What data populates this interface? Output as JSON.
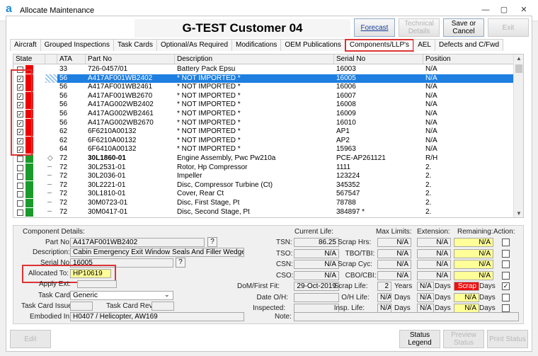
{
  "window": {
    "title": "Allocate Maintenance",
    "minimize": "—",
    "restore": "▢",
    "close": "✕"
  },
  "header": {
    "customer": "G-TEST Customer 04"
  },
  "header_buttons": [
    {
      "label": "Forecast"
    },
    {
      "label": "Technical Details"
    },
    {
      "label": "Save or Cancel"
    },
    {
      "label": "Exit"
    }
  ],
  "tabs": [
    "Aircraft",
    "Grouped Inspections",
    "Task Cards",
    "Optional/As Required",
    "Modifications",
    "OEM Publications",
    "Components/LLP's",
    "AEL",
    "Defects and C/Fwd"
  ],
  "grid": {
    "columns": [
      "State",
      "ATA",
      "Part No",
      "Description",
      "Serial No",
      "Position"
    ],
    "rows": [
      {
        "checked": false,
        "color": "#ee0000",
        "ata": "33",
        "part": "726-0457/01",
        "desc": "Battery Pack Epsu",
        "serial": "16003",
        "pos": "N/A",
        "bold": false,
        "tree": ""
      },
      {
        "checked": true,
        "color": "#ee0000",
        "ata": "56",
        "part": "A417AF001WB2402",
        "desc": "* NOT IMPORTED *",
        "serial": "16005",
        "pos": "N/A",
        "bold": false,
        "tree": "",
        "selected": true
      },
      {
        "checked": true,
        "color": "#ee0000",
        "ata": "56",
        "part": "A417AF001WB2461",
        "desc": "* NOT IMPORTED *",
        "serial": "16006",
        "pos": "N/A",
        "bold": false,
        "tree": ""
      },
      {
        "checked": true,
        "color": "#ee0000",
        "ata": "56",
        "part": "A417AF001WB2670",
        "desc": "* NOT IMPORTED *",
        "serial": "16007",
        "pos": "N/A",
        "bold": false,
        "tree": ""
      },
      {
        "checked": true,
        "color": "#ee0000",
        "ata": "56",
        "part": "A417AG002WB2402",
        "desc": "* NOT IMPORTED *",
        "serial": "16008",
        "pos": "N/A",
        "bold": false,
        "tree": ""
      },
      {
        "checked": true,
        "color": "#ee0000",
        "ata": "56",
        "part": "A417AG002WB2461",
        "desc": "* NOT IMPORTED *",
        "serial": "16009",
        "pos": "N/A",
        "bold": false,
        "tree": ""
      },
      {
        "checked": true,
        "color": "#ee0000",
        "ata": "56",
        "part": "A417AG002WB2670",
        "desc": "* NOT IMPORTED *",
        "serial": "16010",
        "pos": "N/A",
        "bold": false,
        "tree": ""
      },
      {
        "checked": true,
        "color": "#ee0000",
        "ata": "62",
        "part": "6F6210A00132",
        "desc": "* NOT IMPORTED *",
        "serial": "AP1",
        "pos": "N/A",
        "bold": false,
        "tree": ""
      },
      {
        "checked": true,
        "color": "#ee0000",
        "ata": "62",
        "part": "6F6210A00132",
        "desc": "* NOT IMPORTED *",
        "serial": "AP2",
        "pos": "N/A",
        "bold": false,
        "tree": ""
      },
      {
        "checked": true,
        "color": "#ee0000",
        "ata": "64",
        "part": "6F6410A00132",
        "desc": "* NOT IMPORTED *",
        "serial": "15963",
        "pos": "N/A",
        "bold": false,
        "tree": ""
      },
      {
        "checked": false,
        "color": "#1a9a2a",
        "ata": "72",
        "part": "30L1860-01",
        "desc": "Engine Assembly, Pwc Pw210a",
        "serial": "PCE-AP261121",
        "pos": "R/H",
        "bold": true,
        "tree": "◇"
      },
      {
        "checked": false,
        "color": "#1a9a2a",
        "ata": "72",
        "part": "30L2531-01",
        "desc": "Rotor, Hp Compressor",
        "serial": "1111",
        "pos": "2.",
        "bold": false,
        "tree": "┄"
      },
      {
        "checked": false,
        "color": "#1a9a2a",
        "ata": "72",
        "part": "30L2036-01",
        "desc": "Impeller",
        "serial": "123224",
        "pos": "2.",
        "bold": false,
        "tree": "┄"
      },
      {
        "checked": false,
        "color": "#1a9a2a",
        "ata": "72",
        "part": "30L2221-01",
        "desc": "Disc, Compressor Turbine (Ct)",
        "serial": "345352",
        "pos": "2.",
        "bold": false,
        "tree": "┄"
      },
      {
        "checked": false,
        "color": "#1a9a2a",
        "ata": "72",
        "part": "30L1810-01",
        "desc": "Cover, Rear Ct",
        "serial": "567547",
        "pos": "2.",
        "bold": false,
        "tree": "┄"
      },
      {
        "checked": false,
        "color": "#1a9a2a",
        "ata": "72",
        "part": "30M0723-01",
        "desc": "Disc, First Stage, Pt",
        "serial": "78788",
        "pos": "2.",
        "bold": false,
        "tree": "┄"
      },
      {
        "checked": false,
        "color": "#1a9a2a",
        "ata": "72",
        "part": "30M0417-01",
        "desc": "Disc, Second Stage, Pt",
        "serial": "384897 *",
        "pos": "2.",
        "bold": false,
        "tree": "┄"
      }
    ]
  },
  "details": {
    "section_title": "Component Details:",
    "part_no_label": "Part No:",
    "part_no": "A417AF001WB2402",
    "description_label": "Description:",
    "description": "Cabin Emergency Exit Window Seals And Filler Wedges",
    "serial_no_label": "Serial No:",
    "serial_no": "16005",
    "allocated_to_label": "Allocated To:",
    "allocated_to": "HP10619",
    "apply_ext_label": "Apply Ext:",
    "task_card_label": "Task Card:",
    "task_card": "Generic",
    "task_card_issue_label": "Task Card Issue:",
    "task_card_rev_label": "Task Card Rev:",
    "embodied_in_label": "Embodied In:",
    "embodied_in": "H0407 / Helicopter, AW169",
    "help": "?"
  },
  "life": {
    "current_life_header": "Current Life:",
    "max_limits_header": "Max Limits:",
    "extension_header": "Extension:",
    "remaining_header": "Remaining:",
    "action_header": "Action:",
    "rows": [
      {
        "label": "TSN:",
        "current": "86.25",
        "limit_label": "Scrap Hrs:",
        "limit": "N/A",
        "ext": "N/A",
        "remaining": "N/A",
        "rem_style": "y",
        "action": false
      },
      {
        "label": "TSO:",
        "current": "N/A",
        "limit_label": "TBO/TBI:",
        "limit": "N/A",
        "ext": "N/A",
        "remaining": "N/A",
        "rem_style": "y",
        "action": false
      },
      {
        "label": "CSN:",
        "current": "N/A",
        "limit_label": "Scrap Cyc:",
        "limit": "N/A",
        "ext": "N/A",
        "remaining": "N/A",
        "rem_style": "y",
        "action": false
      },
      {
        "label": "CSO:",
        "current": "N/A",
        "limit_label": "CBO/CBI:",
        "limit": "N/A",
        "ext": "N/A",
        "remaining": "N/A",
        "rem_style": "y",
        "action": false
      },
      {
        "label": "DoM/First Fit:",
        "current": "29-Oct-2019",
        "limit_label": "Scrap Life:",
        "limit": "2",
        "limit_unit": "Years",
        "ext": "N/A",
        "ext_unit": "Days",
        "remaining": "Scrap",
        "rem_style": "red",
        "rem_unit": "Days",
        "action": true
      },
      {
        "label": "Date O/H:",
        "current": "",
        "limit_label": "O/H Life:",
        "limit": "N/A",
        "limit_unit": "Days",
        "ext": "N/A",
        "ext_unit": "Days",
        "remaining": "N/A",
        "rem_style": "y",
        "rem_unit": "Days",
        "action": false
      },
      {
        "label": "Inspected:",
        "current": "",
        "limit_label": "Insp. Life:",
        "limit": "N/A",
        "limit_unit": "Days",
        "ext": "N/A",
        "ext_unit": "Days",
        "remaining": "N/A",
        "rem_style": "y",
        "rem_unit": "Days",
        "action": false
      }
    ],
    "note_label": "Note:"
  },
  "bottom_buttons": [
    {
      "label": "Edit"
    },
    {
      "label": "Status Legend"
    },
    {
      "label": "Preview Status"
    },
    {
      "label": "Print Status"
    }
  ]
}
